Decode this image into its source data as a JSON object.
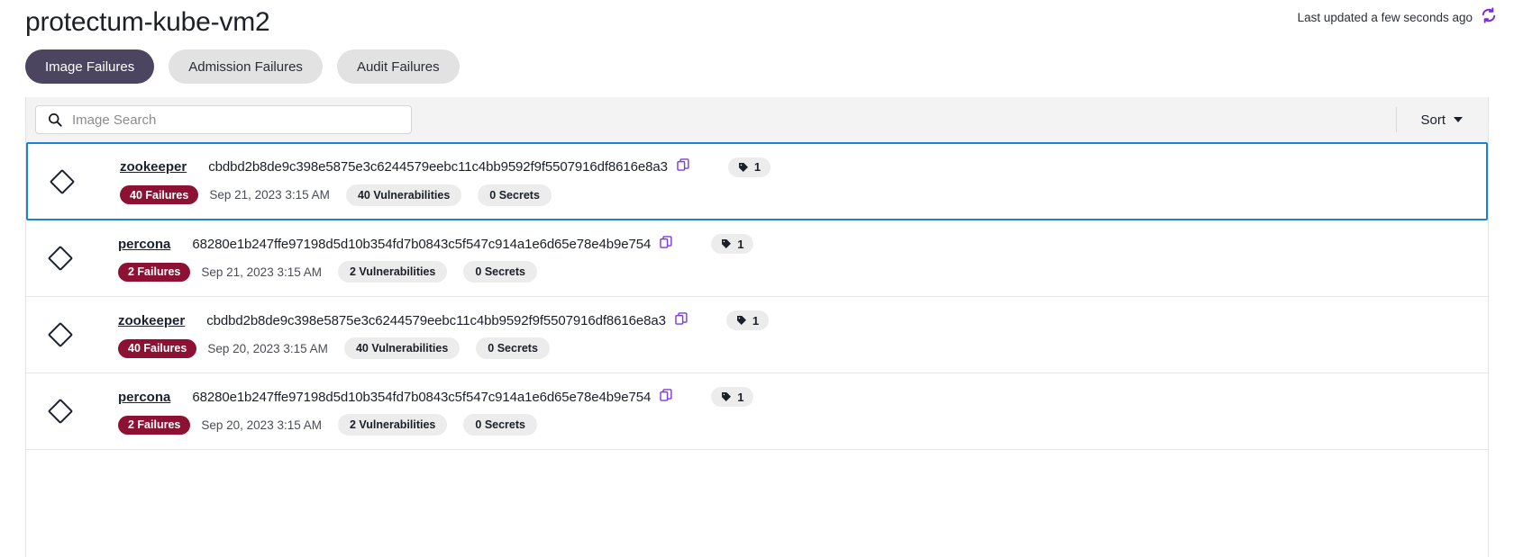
{
  "header": {
    "title": "protectum-kube-vm2",
    "last_updated": "Last updated a few seconds ago",
    "refresh_icon": "refresh-sync-icon",
    "refresh_color": "#7d28d9"
  },
  "tabs": [
    {
      "label": "Image Failures",
      "active": true
    },
    {
      "label": "Admission Failures",
      "active": false
    },
    {
      "label": "Audit Failures",
      "active": false
    }
  ],
  "toolbar": {
    "search_placeholder": "Image Search",
    "search_value": "",
    "search_icon": "search-icon",
    "sort_label": "Sort",
    "sort_caret": "chevron-down-icon"
  },
  "colors": {
    "tab_active_bg": "#4c4560",
    "tab_inactive_bg": "#e2e2e2",
    "failures_badge_bg": "#8c1133",
    "pill_bg": "#ececec",
    "selected_row_border": "#1c82d4",
    "accent_purple": "#7d28d9",
    "toolbar_bg": "#f3f3f3"
  },
  "rows": [
    {
      "selected": true,
      "icon": "diamond-icon",
      "repository": "zookeeper",
      "digest": "cbdbd2b8de9c398e5875e3c6244579eebc11c4bb9592f9f5507916df8616e8a3",
      "copy_icon": "copy-icon",
      "tag_icon": "tag-icon",
      "tag_count": "1",
      "failures_badge": "40 Failures",
      "date": "Sep 21, 2023 3:15 AM",
      "vulnerabilities": "40 Vulnerabilities",
      "secrets": "0 Secrets"
    },
    {
      "selected": false,
      "icon": "diamond-icon",
      "repository": "percona",
      "digest": "68280e1b247ffe97198d5d10b354fd7b0843c5f547c914a1e6d65e78e4b9e754",
      "copy_icon": "copy-icon",
      "tag_icon": "tag-icon",
      "tag_count": "1",
      "failures_badge": "2 Failures",
      "date": "Sep 21, 2023 3:15 AM",
      "vulnerabilities": "2 Vulnerabilities",
      "secrets": "0 Secrets"
    },
    {
      "selected": false,
      "icon": "diamond-icon",
      "repository": "zookeeper",
      "digest": "cbdbd2b8de9c398e5875e3c6244579eebc11c4bb9592f9f5507916df8616e8a3",
      "copy_icon": "copy-icon",
      "tag_icon": "tag-icon",
      "tag_count": "1",
      "failures_badge": "40 Failures",
      "date": "Sep 20, 2023 3:15 AM",
      "vulnerabilities": "40 Vulnerabilities",
      "secrets": "0 Secrets"
    },
    {
      "selected": false,
      "icon": "diamond-icon",
      "repository": "percona",
      "digest": "68280e1b247ffe97198d5d10b354fd7b0843c5f547c914a1e6d65e78e4b9e754",
      "copy_icon": "copy-icon",
      "tag_icon": "tag-icon",
      "tag_count": "1",
      "failures_badge": "2 Failures",
      "date": "Sep 20, 2023 3:15 AM",
      "vulnerabilities": "2 Vulnerabilities",
      "secrets": "0 Secrets"
    }
  ]
}
